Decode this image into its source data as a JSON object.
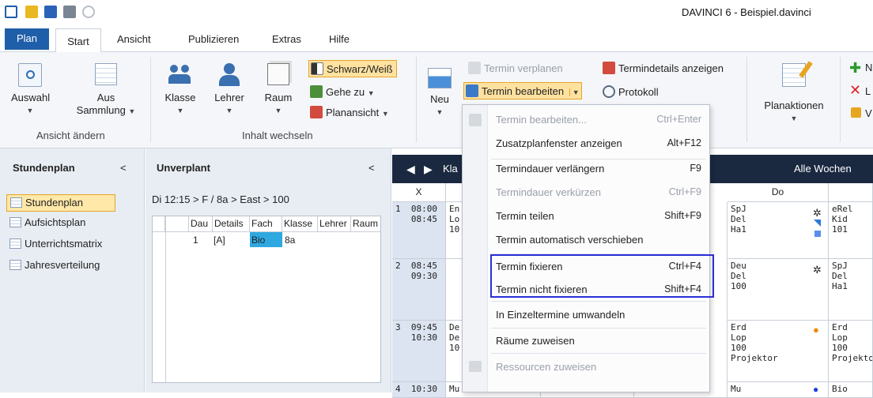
{
  "window": {
    "title": "DAVINCI 6 - Beispiel.davinci"
  },
  "tabs": {
    "plan": "Plan",
    "items": [
      "Start",
      "Ansicht",
      "Publizieren",
      "Extras",
      "Hilfe"
    ]
  },
  "ribbon": {
    "auswahl": "Auswahl",
    "aus": "Aus",
    "sammlung": "Sammlung",
    "group1": "Ansicht ändern",
    "klasse": "Klasse",
    "lehrer": "Lehrer",
    "raum": "Raum",
    "schwarz_weiss": "Schwarz/Weiß",
    "gehe_zu": "Gehe zu",
    "planansicht": "Planansicht",
    "group2": "Inhalt wechseln",
    "neu": "Neu",
    "termin_verplanen": "Termin verplanen",
    "termin_bearbeiten": "Termin bearbeiten",
    "termindetails": "Termindetails anzeigen",
    "protokoll": "Protokoll",
    "planaktionen": "Planaktionen",
    "right_n": "N",
    "right_l": "L",
    "right_v": "V"
  },
  "left_panel": {
    "title": "Stundenplan",
    "collapse": "<",
    "items": [
      "Stundenplan",
      "Aufsichtsplan",
      "Unterrichtsmatrix",
      "Jahresverteilung"
    ]
  },
  "unverplant": {
    "title": "Unverplant",
    "collapse": "<",
    "path": "Di 12:15 > F / 8a > East > 100",
    "columns": [
      "Dau",
      "Details",
      "Fach",
      "Klasse",
      "Lehrer",
      "Raum"
    ],
    "row": {
      "dau": "1",
      "details": "[A]",
      "fach": "Bio",
      "klasse": "8a"
    }
  },
  "schedule": {
    "nav_label": "Kla",
    "all_weeks": "Alle Wochen",
    "col_x": "X",
    "do": "Do",
    "periods": [
      {
        "n": "1",
        "from": "08:00",
        "to": "08:45"
      },
      {
        "n": "2",
        "from": "08:45",
        "to": "09:30"
      },
      {
        "n": "3",
        "from": "09:45",
        "to": "10:30"
      },
      {
        "n": "4",
        "from": "10:30",
        "to": ""
      }
    ],
    "mon_frag": {
      "p1a": "En",
      "p1b": "Lo",
      "p1c": "10",
      "p3a": "De",
      "p3b": "De",
      "p3c": "10",
      "p4": "Mu"
    },
    "do_cells": {
      "p1": {
        "a": "SpJ",
        "b": "Del",
        "c": "Ha1"
      },
      "p2": {
        "a": "Deu",
        "b": "Del",
        "c": "100"
      },
      "p3": {
        "a": "Erd",
        "b": "Lop",
        "c": "100",
        "d": "Projektor"
      },
      "p4": {
        "a": "Mu"
      }
    },
    "fr_cells": {
      "p1": {
        "a": "eRel",
        "b": "Kid",
        "c": "101"
      },
      "p2": {
        "a": "SpJ",
        "b": "Del",
        "c": "Ha1"
      },
      "p3": {
        "a": "Erd",
        "b": "Lop",
        "c": "100",
        "d": "Projekto"
      },
      "p4": {
        "a": "Bio"
      }
    }
  },
  "context_menu": {
    "items": [
      {
        "label": "Termin bearbeiten...",
        "shortcut": "Ctrl+Enter",
        "disabled": true
      },
      {
        "label": "Zusatzplanfenster anzeigen",
        "shortcut": "Alt+F12",
        "disabled": false
      },
      {
        "label": "Termindauer verlängern",
        "shortcut": "F9",
        "disabled": false
      },
      {
        "label": "Termindauer verkürzen",
        "shortcut": "Ctrl+F9",
        "disabled": true
      },
      {
        "label": "Termin teilen",
        "shortcut": "Shift+F9",
        "disabled": false
      },
      {
        "label": "Termin automatisch verschieben",
        "shortcut": "",
        "disabled": false
      },
      {
        "label": "Termin fixieren",
        "shortcut": "Ctrl+F4",
        "disabled": false
      },
      {
        "label": "Termin nicht fixieren",
        "shortcut": "Shift+F4",
        "disabled": false
      },
      {
        "label": "In Einzeltermine umwandeln",
        "shortcut": "",
        "disabled": false
      },
      {
        "label": "Räume zuweisen",
        "shortcut": "",
        "disabled": false
      },
      {
        "label": "Ressourcen zuweisen",
        "shortcut": "",
        "disabled": true
      }
    ]
  },
  "colors": {
    "accent": "#1f5ea8",
    "highlight_box": "#2a2fd6",
    "fach_cell": "#2ea8e0",
    "active_nav": "#ffe8a8"
  }
}
